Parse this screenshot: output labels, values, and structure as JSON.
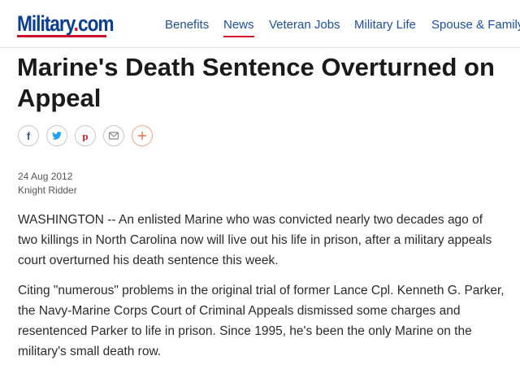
{
  "header": {
    "logo": {
      "text": "Military",
      "dot": ".",
      "suffix": "com"
    },
    "nav": [
      {
        "label": "Benefits",
        "active": false
      },
      {
        "label": "News",
        "active": true
      },
      {
        "label": "Veteran Jobs",
        "active": false
      },
      {
        "label": "Military Life",
        "active": false
      },
      {
        "label": "Spouse & Family",
        "active": false
      }
    ]
  },
  "article": {
    "title": "Marine's Death Sentence Overturned on Appeal",
    "share": [
      {
        "icon": "facebook-icon",
        "color": "#3b5998"
      },
      {
        "icon": "twitter-icon",
        "color": "#1da1f2"
      },
      {
        "icon": "pinterest-icon",
        "color": "#cb2027"
      },
      {
        "icon": "email-icon",
        "color": "#8a8a8a"
      },
      {
        "icon": "plus-icon",
        "color": "#e8734a"
      }
    ],
    "date": "24 Aug 2012",
    "source": "Knight Ridder",
    "paragraphs": [
      "WASHINGTON -- An enlisted Marine who was convicted nearly two decades ago of two killings in North Carolina now will live out his life in prison, after a military appeals court overturned his death sentence this week.",
      "Citing \"numerous\" problems in the original trial of former Lance Cpl. Kenneth G. Parker, the Navy-Marine Corps Court of Criminal Appeals dismissed some charges and resentenced Parker to life in prison. Since 1995, he's been the only Marine on the military's small death row."
    ]
  },
  "colors": {
    "brand_blue": "#0b3d91",
    "brand_red": "#d0112b",
    "nav_blue": "#1e4fa1"
  }
}
